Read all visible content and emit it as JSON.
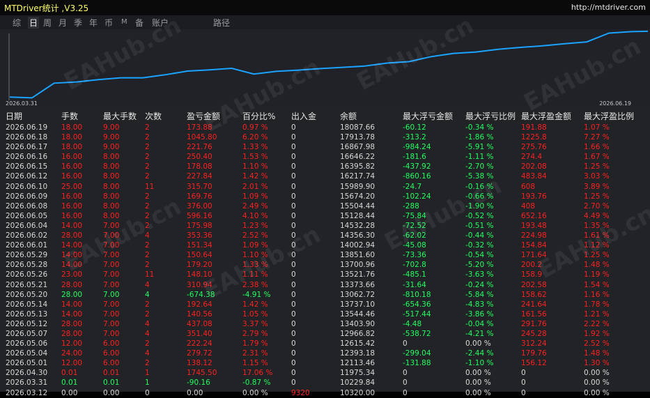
{
  "app": {
    "title": "MTDriver统计 ,V3.25",
    "url": "http://mtdriver.com"
  },
  "tabs": [
    "综",
    "日",
    "周",
    "月",
    "季",
    "年",
    "币",
    "M",
    "备",
    "账户",
    "路径"
  ],
  "active_tab": 1,
  "colors": {
    "accent_line": "#1aa3ff",
    "profit": "#ff2020",
    "loss": "#20ff60",
    "title": "#ffff66"
  },
  "watermark": "EAHub.cn",
  "chart": {
    "start_label": "2026.03.31",
    "end_label": "2026.06.19"
  },
  "chart_data": {
    "type": "line",
    "title": "",
    "xlabel": "",
    "ylabel": "",
    "x": [
      "2026.03.12",
      "2026.03.31",
      "2026.04.30",
      "2026.05.01",
      "2026.05.04",
      "2026.05.05",
      "2026.05.06",
      "2026.05.07",
      "2026.05.12",
      "2026.05.13",
      "2026.05.14",
      "2026.05.20",
      "2026.05.21",
      "2026.05.26",
      "2026.05.28",
      "2026.05.29",
      "2026.06.01",
      "2026.06.02",
      "2026.06.04",
      "2026.06.05",
      "2026.06.08",
      "2026.06.09",
      "2026.06.10",
      "2026.06.12",
      "2026.06.15",
      "2026.06.16",
      "2026.06.17",
      "2026.06.18",
      "2026.06.19"
    ],
    "series": [
      {
        "values": [
          10320.0,
          10229.84,
          11975.34,
          12113.46,
          12393.18,
          12615.42,
          12615.42,
          12966.82,
          13403.9,
          13544.46,
          13737.1,
          13062.72,
          13373.66,
          13521.76,
          13700.96,
          13851.6,
          14002.94,
          14356.3,
          14532.28,
          15128.44,
          15504.44,
          15674.2,
          15989.9,
          16217.74,
          16395.82,
          16646.22,
          16867.98,
          17913.78,
          18087.66
        ]
      }
    ]
  },
  "table": {
    "headers": [
      "日期",
      "手数",
      "最大手数",
      "次数",
      "盈亏金额",
      "百分比%",
      "出入金",
      "余额",
      "最大浮亏金额",
      "最大浮亏比例",
      "最大浮盈金额",
      "最大浮盈比例"
    ],
    "rows": [
      [
        "2026.06.19",
        "18.00",
        "9.00",
        "2",
        "173.88",
        "0.97 %",
        "0",
        "18087.66",
        "-60.12",
        "-0.34 %",
        "191.88",
        "1.07 %"
      ],
      [
        "2026.06.18",
        "18.00",
        "9.00",
        "2",
        "1045.80",
        "6.20 %",
        "0",
        "17913.78",
        "-313.2",
        "-1.86 %",
        "1225.8",
        "7.27 %"
      ],
      [
        "2026.06.17",
        "18.00",
        "9.00",
        "2",
        "221.76",
        "1.33 %",
        "0",
        "16867.98",
        "-984.24",
        "-5.91 %",
        "275.76",
        "1.66 %"
      ],
      [
        "2026.06.16",
        "16.00",
        "8.00",
        "2",
        "250.40",
        "1.53 %",
        "0",
        "16646.22",
        "-181.6",
        "-1.11 %",
        "274.4",
        "1.67 %"
      ],
      [
        "2026.06.15",
        "16.00",
        "8.00",
        "2",
        "178.08",
        "1.10 %",
        "0",
        "16395.82",
        "-437.92",
        "-2.70 %",
        "202.08",
        "1.25 %"
      ],
      [
        "2026.06.12",
        "16.00",
        "8.00",
        "2",
        "227.84",
        "1.42 %",
        "0",
        "16217.74",
        "-860.16",
        "-5.38 %",
        "483.84",
        "3.03 %"
      ],
      [
        "2026.06.10",
        "25.00",
        "8.00",
        "11",
        "315.70",
        "2.01 %",
        "0",
        "15989.90",
        "-24.7",
        "-0.16 %",
        "608",
        "3.89 %"
      ],
      [
        "2026.06.09",
        "16.00",
        "8.00",
        "2",
        "169.76",
        "1.09 %",
        "0",
        "15674.20",
        "-102.24",
        "-0.66 %",
        "193.76",
        "1.25 %"
      ],
      [
        "2026.06.08",
        "16.00",
        "8.00",
        "2",
        "376.00",
        "2.49 %",
        "0",
        "15504.44",
        "-288",
        "-1.90 %",
        "408",
        "2.70 %"
      ],
      [
        "2026.06.05",
        "16.00",
        "8.00",
        "2",
        "596.16",
        "4.10 %",
        "0",
        "15128.44",
        "-75.84",
        "-0.52 %",
        "652.16",
        "4.49 %"
      ],
      [
        "2026.06.04",
        "14.00",
        "7.00",
        "2",
        "175.98",
        "1.23 %",
        "0",
        "14532.28",
        "-72.52",
        "-0.51 %",
        "193.48",
        "1.35 %"
      ],
      [
        "2026.06.02",
        "28.00",
        "7.00",
        "4",
        "353.36",
        "2.52 %",
        "0",
        "14356.30",
        "-62.02",
        "-0.44 %",
        "224.98",
        "1.61 %"
      ],
      [
        "2026.06.01",
        "14.00",
        "7.00",
        "2",
        "151.34",
        "1.09 %",
        "0",
        "14002.94",
        "-45.08",
        "-0.32 %",
        "154.84",
        "1.12 %"
      ],
      [
        "2026.05.29",
        "14.00",
        "7.00",
        "2",
        "150.64",
        "1.10 %",
        "0",
        "13851.60",
        "-73.36",
        "-0.54 %",
        "171.64",
        "1.25 %"
      ],
      [
        "2026.05.28",
        "14.00",
        "7.00",
        "2",
        "179.20",
        "1.33 %",
        "0",
        "13700.96",
        "-702.8",
        "-5.20 %",
        "200.2",
        "1.48 %"
      ],
      [
        "2026.05.26",
        "23.00",
        "7.00",
        "11",
        "148.10",
        "1.11 %",
        "0",
        "13521.76",
        "-485.1",
        "-3.63 %",
        "158.9",
        "1.19 %"
      ],
      [
        "2026.05.21",
        "28.00",
        "7.00",
        "4",
        "310.94",
        "2.38 %",
        "0",
        "13373.66",
        "-31.64",
        "-0.24 %",
        "202.58",
        "1.54 %"
      ],
      [
        "2026.05.20",
        "28.00",
        "7.00",
        "4",
        "-674.38",
        "-4.91 %",
        "0",
        "13062.72",
        "-810.18",
        "-5.84 %",
        "158.62",
        "1.16 %"
      ],
      [
        "2026.05.14",
        "14.00",
        "7.00",
        "2",
        "192.64",
        "1.42 %",
        "0",
        "13737.10",
        "-654.36",
        "-4.83 %",
        "241.64",
        "1.78 %"
      ],
      [
        "2026.05.13",
        "14.00",
        "7.00",
        "2",
        "140.56",
        "1.05 %",
        "0",
        "13544.46",
        "-517.44",
        "-3.86 %",
        "161.56",
        "1.21 %"
      ],
      [
        "2026.05.12",
        "28.00",
        "7.00",
        "4",
        "437.08",
        "3.37 %",
        "0",
        "13403.90",
        "-4.48",
        "-0.04 %",
        "291.76",
        "2.22 %"
      ],
      [
        "2026.05.07",
        "28.00",
        "7.00",
        "4",
        "351.40",
        "2.79 %",
        "0",
        "12966.82",
        "-538.72",
        "-4.21 %",
        "245.28",
        "1.92 %"
      ],
      [
        "2026.05.06",
        "12.00",
        "6.00",
        "2",
        "222.24",
        "1.79 %",
        "0",
        "12615.42",
        "0",
        "0.00 %",
        "312.24",
        "2.52 %"
      ],
      [
        "2026.05.04",
        "24.00",
        "6.00",
        "4",
        "279.72",
        "2.31 %",
        "0",
        "12393.18",
        "-299.04",
        "-2.44 %",
        "179.76",
        "1.48 %"
      ],
      [
        "2026.05.01",
        "12.00",
        "6.00",
        "2",
        "138.12",
        "1.15 %",
        "0",
        "12113.46",
        "-131.88",
        "-1.10 %",
        "156.12",
        "1.30 %"
      ],
      [
        "2026.04.30",
        "0.01",
        "0.01",
        "1",
        "1745.50",
        "17.06 %",
        "0",
        "11975.34",
        "0",
        "0.00 %",
        "0",
        "0.00 %"
      ],
      [
        "2026.03.31",
        "0.01",
        "0.01",
        "1",
        "-90.16",
        "-0.87 %",
        "0",
        "10229.84",
        "0",
        "0.00 %",
        "0",
        "0.00 %"
      ],
      [
        "2026.03.12",
        "0.00",
        "0.00",
        "0",
        "0.00",
        "0.00 %",
        "9320",
        "10320.00",
        "0",
        "0.00 %",
        "0",
        "0.00 %"
      ]
    ]
  }
}
